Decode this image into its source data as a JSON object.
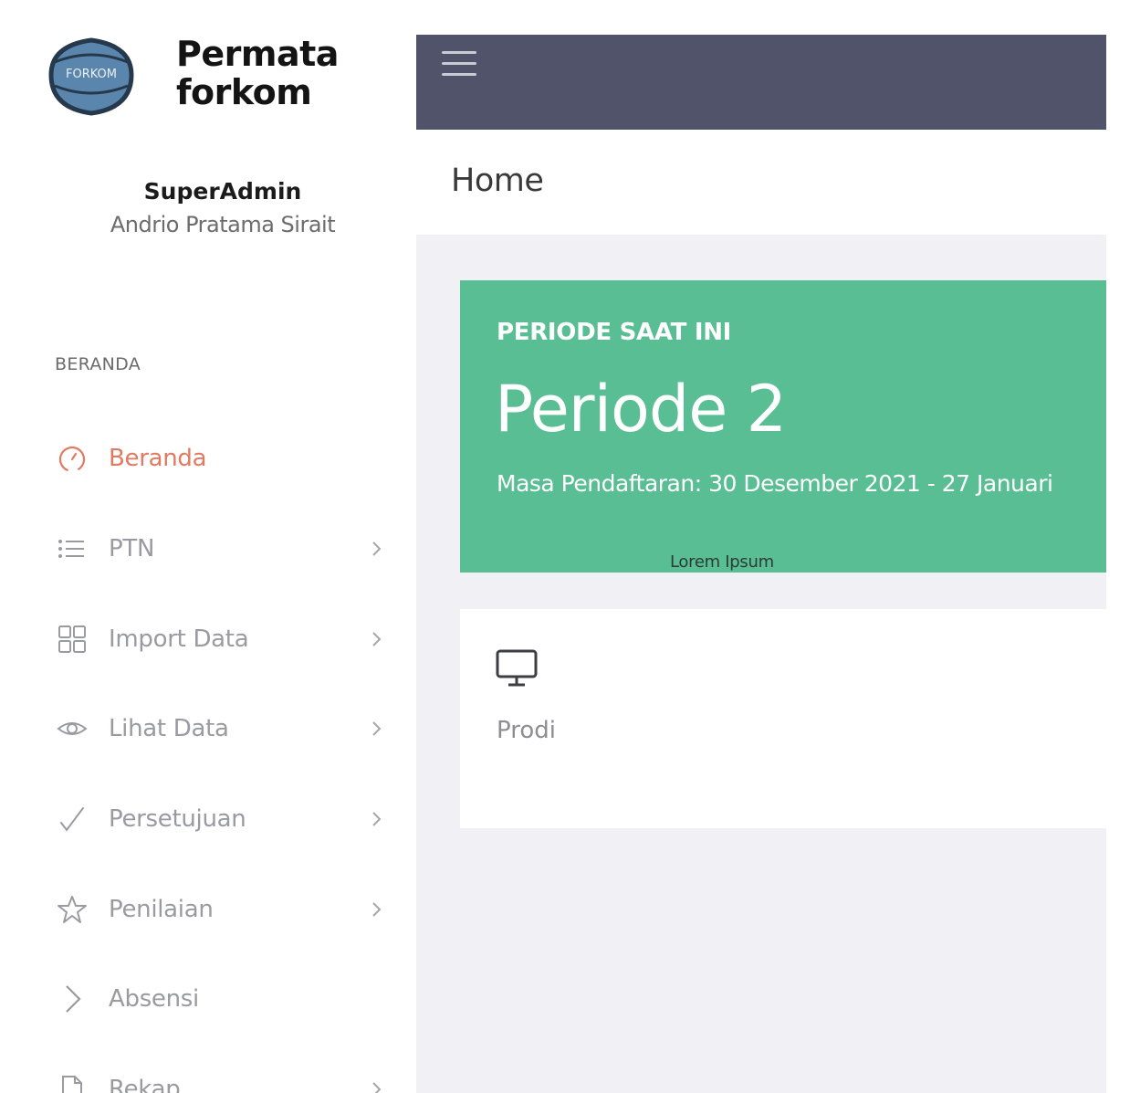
{
  "brand": {
    "name_line1": "Permata",
    "name_line2": "forkom",
    "logo_text": "FORKOM"
  },
  "profile": {
    "role": "SuperAdmin",
    "name": "Andrio Pratama Sirait"
  },
  "sidebar": {
    "section_heading": "BERANDA",
    "items": [
      {
        "label": "Beranda",
        "icon": "dashboard-icon",
        "active": true,
        "has_chevron": false
      },
      {
        "label": "PTN",
        "icon": "list-icon",
        "active": false,
        "has_chevron": true
      },
      {
        "label": "Import Data",
        "icon": "grid-icon",
        "active": false,
        "has_chevron": true
      },
      {
        "label": "Lihat Data",
        "icon": "eye-icon",
        "active": false,
        "has_chevron": true
      },
      {
        "label": "Persetujuan",
        "icon": "check-icon",
        "active": false,
        "has_chevron": true
      },
      {
        "label": "Penilaian",
        "icon": "star-icon",
        "active": false,
        "has_chevron": true
      },
      {
        "label": "Absensi",
        "icon": "chevron-right-icon",
        "active": false,
        "has_chevron": false
      },
      {
        "label": "Rekap",
        "icon": "file-icon",
        "active": false,
        "has_chevron": true
      }
    ]
  },
  "page": {
    "title": "Home"
  },
  "period_card": {
    "label": "PERIODE SAAT INI",
    "value": "Periode 2",
    "registration": "Masa Pendaftaran: 30 Desember 2021 - 27 Januari",
    "note": "Lorem Ipsum"
  },
  "stat_card": {
    "icon": "monitor-icon",
    "label": "Prodi"
  },
  "colors": {
    "topbar": "#50536a",
    "accent_active": "#e07a62",
    "card_green": "#59be93",
    "content_bg": "#f1f1f5"
  }
}
